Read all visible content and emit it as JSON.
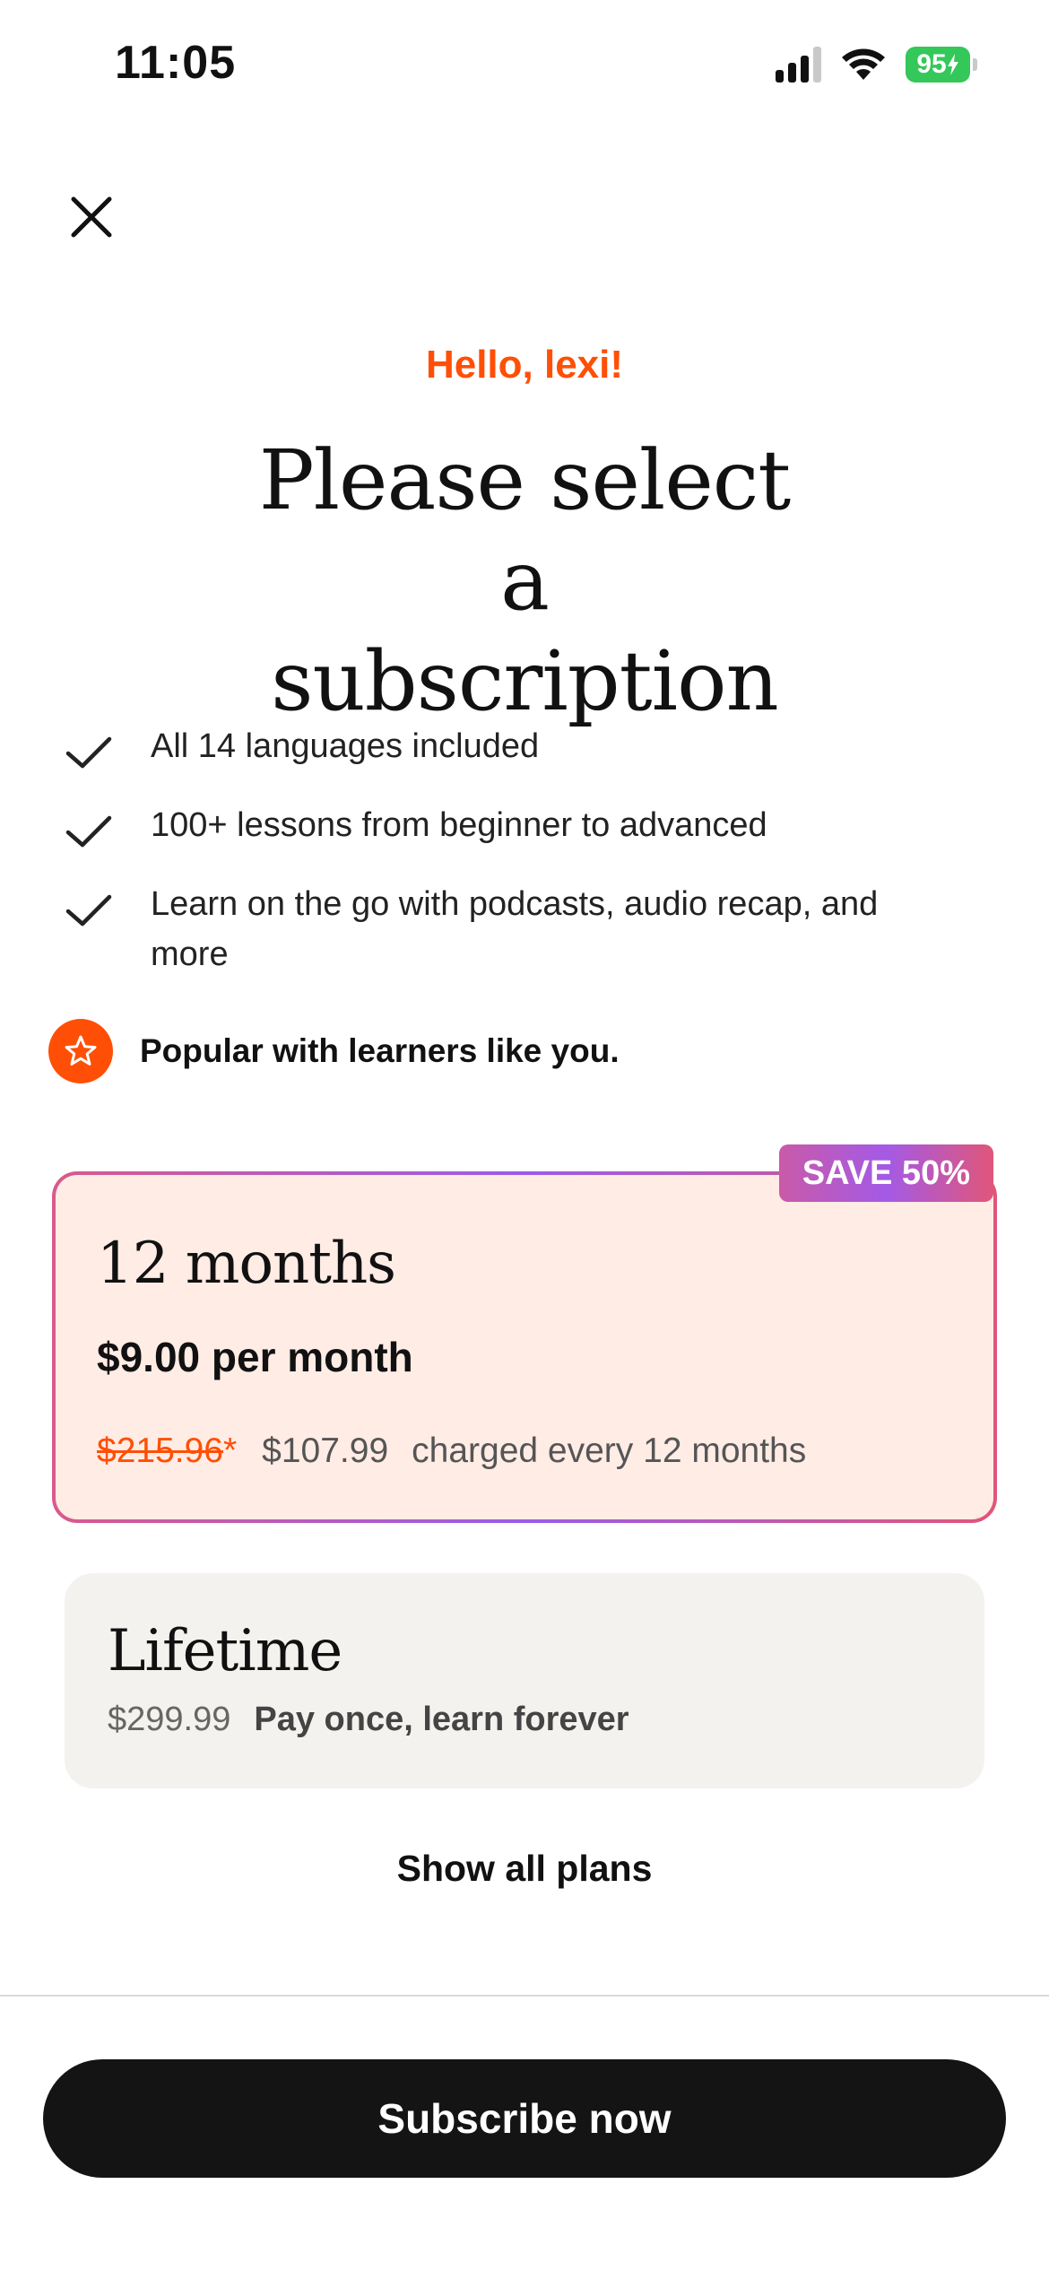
{
  "status_bar": {
    "time": "11:05",
    "battery": "95",
    "icons": [
      "cellular-signal-icon",
      "wifi-icon",
      "battery-charging-icon"
    ],
    "battery_level": 0.95
  },
  "header": {
    "greeting": "Hello, lexi!",
    "title": "Please select a subscription"
  },
  "features": [
    {
      "text": "All 14 languages included",
      "icon": "checkmark-icon"
    },
    {
      "text": "100+ lessons from beginner to advanced",
      "icon": "checkmark-icon"
    },
    {
      "text": "Learn on the go with podcasts, audio recap, and more",
      "icon": "checkmark-icon"
    }
  ],
  "popular": {
    "text": "Popular with learners like you.",
    "icon": "star-icon"
  },
  "plans": {
    "year": {
      "badge": "SAVE 50%",
      "name": "12 months",
      "price_per_month": "$9.00 per month",
      "original_price": "$215.96",
      "asterisk": "*",
      "sale_price": "$107.99",
      "billing": "charged every 12 months",
      "selected": true
    },
    "lifetime": {
      "name": "Lifetime",
      "price": "$299.99",
      "tagline": "Pay once, learn forever",
      "selected": false
    }
  },
  "actions": {
    "show_all": "Show all plans",
    "subscribe": "Subscribe now"
  },
  "colors": {
    "accent": "#ff4f06",
    "selected_bg": "#ffece5",
    "unselected_bg": "#f4f2ee",
    "button": "#141414",
    "battery": "#34c759"
  }
}
